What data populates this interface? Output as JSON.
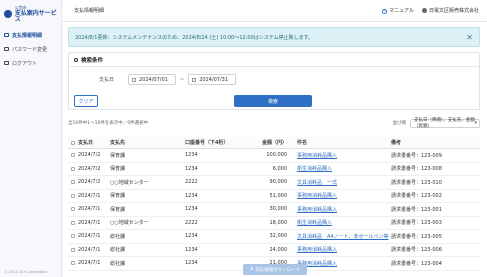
{
  "sidebar": {
    "logo_sub": "公営市",
    "logo_main": "支払案内サービス",
    "items": [
      {
        "label": "支払情報明細",
        "active": true
      },
      {
        "label": "パスワード変更",
        "active": false
      },
      {
        "label": "ログアウト",
        "active": false
      }
    ],
    "copyright": "© 2024 XXX Corporation"
  },
  "header": {
    "title": "支払情報明細",
    "manual": "マニュアル",
    "user": "日電文区販売株式会社"
  },
  "notice": {
    "text": "2024/8/1更新：システムメンテナンスのため、2024/8/24 (土) 10:00〜12:00はシステム停止致します。"
  },
  "search": {
    "title": "検索条件",
    "date_label": "支払日",
    "date_from": "2024/07/01",
    "date_to": "2024/07/31",
    "tilde": "~",
    "clear_label": "クリア",
    "search_label": "検索"
  },
  "results": {
    "count_text": "全10件中1～10件を表示中／0件選択中",
    "sort_label": "並び順",
    "sort_value": "支払日（降順）、支払先、金額（昇順）"
  },
  "table": {
    "headers": [
      "支払日",
      "支払先",
      "口座番号（下4桁）",
      "金額（円）",
      "件名",
      "備考"
    ],
    "rows": [
      [
        "2024/7/2",
        "保育課",
        "1234",
        "100,000",
        "事務用消耗品購入",
        "請求書番号：123-009"
      ],
      [
        "2024/7/2",
        "保育課",
        "1234",
        "6,000",
        "衛生消耗品購入",
        "請求書番号：123-008"
      ],
      [
        "2024/7/2",
        "○○地域センター",
        "2222",
        "90,000",
        "文具消耗品　一式",
        "請求書番号：123-010"
      ],
      [
        "2024/7/1",
        "保育課",
        "1234",
        "51,000",
        "事務用消耗品購入",
        "請求書番号：123-002"
      ],
      [
        "2024/7/1",
        "保育課",
        "1234",
        "30,000",
        "事務用消耗品購入",
        "請求書番号：123-001"
      ],
      [
        "2024/7/1",
        "○○地域センター",
        "2222",
        "18,000",
        "衛生消耗品購入",
        "請求書番号：123-003"
      ],
      [
        "2024/7/1",
        "総社課",
        "1234",
        "32,000",
        "文具消耗品　A4ノート、赤ボールペン等",
        "請求書番号：123-005"
      ],
      [
        "2024/7/1",
        "総社課",
        "1234",
        "24,000",
        "事務用消耗品購入",
        "請求書番号：123-006"
      ],
      [
        "2024/7/1",
        "総社課",
        "1234",
        "21,000",
        "事務用消耗品購入",
        "請求書番号：123-004"
      ]
    ]
  },
  "footer": {
    "download_label": "支払情報ダウンロード"
  },
  "colors": {
    "primary": "#2f6fc6",
    "notice_bg": "#dbf1f5",
    "brand": "#1f4e9c"
  }
}
